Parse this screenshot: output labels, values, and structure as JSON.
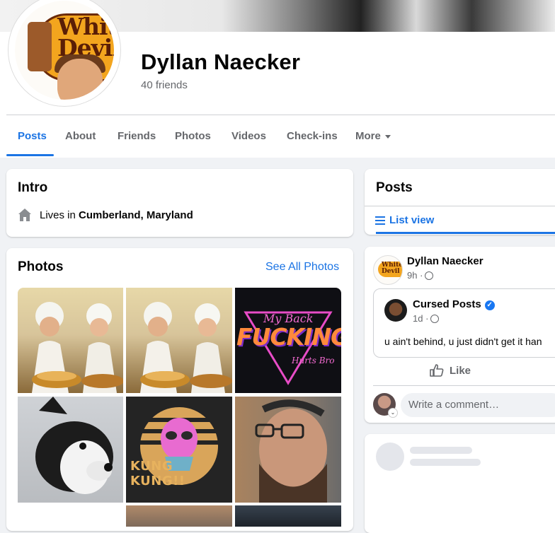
{
  "profile": {
    "name": "Dyllan Naecker",
    "friends": "40 friends",
    "avatar_logo_text": "White Devil"
  },
  "tabs": [
    {
      "label": "Posts",
      "active": true
    },
    {
      "label": "About",
      "active": false
    },
    {
      "label": "Friends",
      "active": false
    },
    {
      "label": "Photos",
      "active": false
    },
    {
      "label": "Videos",
      "active": false
    },
    {
      "label": "Check-ins",
      "active": false
    },
    {
      "label": "More",
      "active": false
    }
  ],
  "intro": {
    "title": "Intro",
    "lives_prefix": "Lives in ",
    "location": "Cumberland, Maryland"
  },
  "photos": {
    "title": "Photos",
    "see_all": "See All Photos",
    "items": [
      {
        "desc": "chefs cooking noodles",
        "icon": "photo-chefs"
      },
      {
        "desc": "chefs cooking noodles",
        "icon": "photo-chefs"
      },
      {
        "text": "My Back FUCKING Hurts Bro",
        "line1": "My Back",
        "line2": "FUCKING",
        "line3": "Hurts Bro"
      },
      {
        "desc": "boston terrier dog",
        "icon": "photo-dog"
      },
      {
        "text": "KUNG KUNG!!"
      },
      {
        "desc": "selfie",
        "icon": "photo-selfie"
      }
    ]
  },
  "posts": {
    "title": "Posts",
    "list_view": "List view",
    "post": {
      "author": "Dyllan Naecker",
      "time": "9h ·",
      "shared": {
        "author": "Cursed Posts",
        "time": "1d ·",
        "text": "u ain't behind, u just didn't get it han"
      },
      "like_label": "Like",
      "comment_placeholder": "Write a comment…"
    }
  },
  "colors": {
    "accent": "#1b74e4",
    "secondary_text": "#65676b",
    "background": "#f0f2f5"
  }
}
